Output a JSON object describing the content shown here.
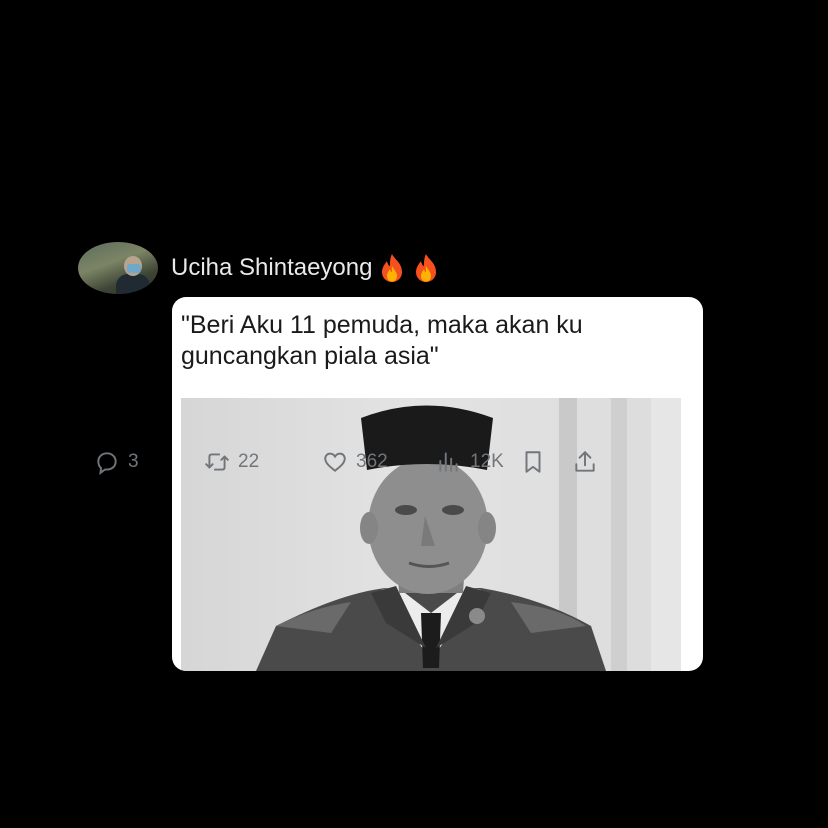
{
  "post": {
    "author": {
      "display_name": "Uciha Shintaeyong",
      "emoji_badges": [
        "fire-icon",
        "fire-icon"
      ]
    },
    "media": {
      "caption": "\"Beri Aku 11 pemuda, maka akan ku guncangkan piala asia\""
    },
    "actions": {
      "replies": "3",
      "reposts": "22",
      "likes": "362",
      "views": "12K",
      "icons": [
        "reply-icon",
        "repost-icon",
        "like-icon",
        "views-icon",
        "bookmark-icon",
        "share-icon"
      ]
    }
  },
  "colors": {
    "background": "#000000",
    "text": "#e7e9ea",
    "muted": "#71767b",
    "card": "#ffffff"
  }
}
